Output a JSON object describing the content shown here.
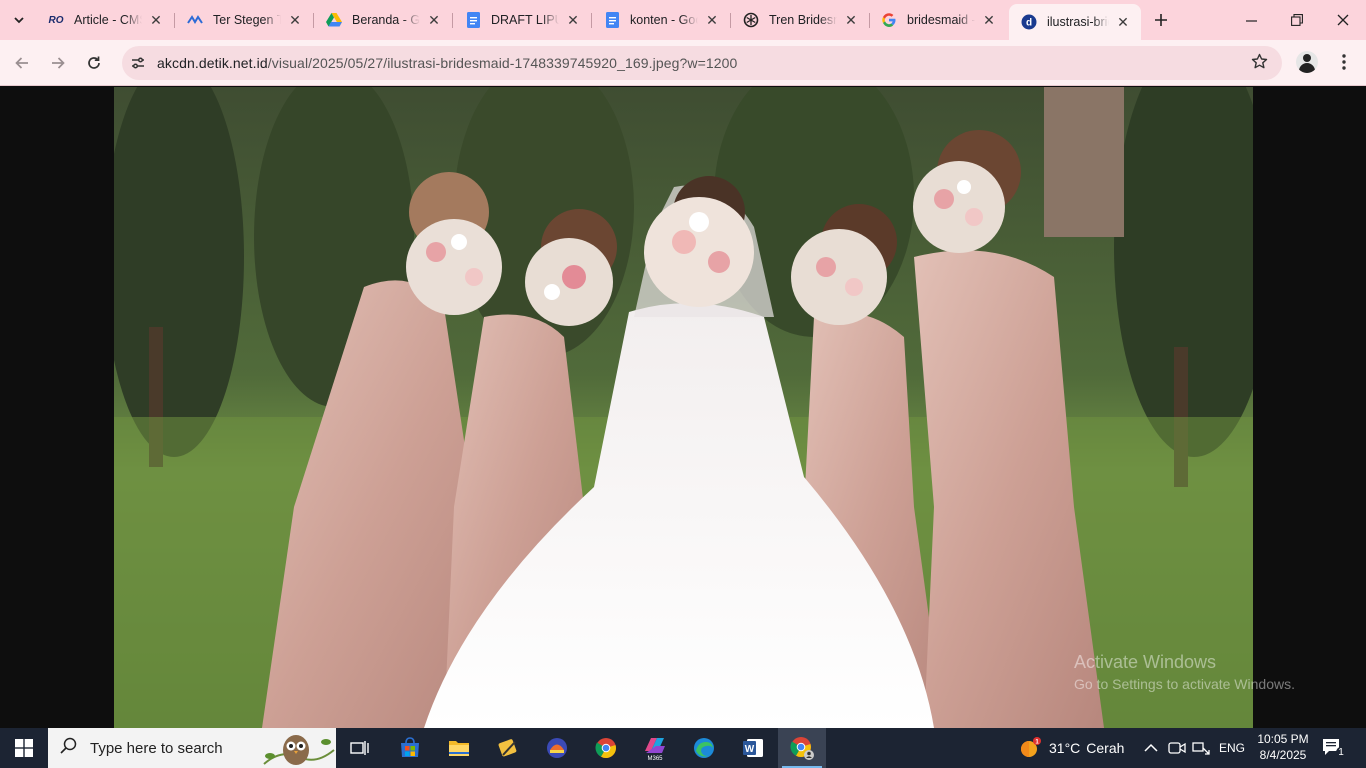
{
  "browser": {
    "tabs": [
      {
        "title": "Article - CMS",
        "favicon": "ro-logo-icon"
      },
      {
        "title": "Ter Stegen Tolak",
        "favicon": "trans-logo-icon"
      },
      {
        "title": "Beranda - Google Drive",
        "favicon": "google-drive-icon"
      },
      {
        "title": "DRAFT LIPUTAN",
        "favicon": "google-docs-icon"
      },
      {
        "title": "konten - Google Docs",
        "favicon": "google-docs-icon"
      },
      {
        "title": "Tren Bridesmaid",
        "favicon": "chatgpt-icon"
      },
      {
        "title": "bridesmaid - Google",
        "favicon": "google-icon"
      },
      {
        "title": "ilustrasi-bridesmaid",
        "favicon": "detik-icon"
      }
    ],
    "active_tab_index": 7,
    "url_host": "akcdn.detik.net.id",
    "url_path": "/visual/2025/05/27/ilustrasi-bridesmaid-1748339745920_169.jpeg?w=1200"
  },
  "watermark": {
    "line1": "Activate Windows",
    "line2": "Go to Settings to activate Windows."
  },
  "taskbar": {
    "search_placeholder": "Type here to search",
    "weather_temp": "31°C",
    "weather_desc": "Cerah",
    "language": "ENG",
    "time": "10:05 PM",
    "date": "8/4/2025",
    "notification_count": "1"
  },
  "colors": {
    "tabstrip": "#fcd4dc",
    "toolbar": "#fdf0f2",
    "taskbar": "#1c2433"
  }
}
